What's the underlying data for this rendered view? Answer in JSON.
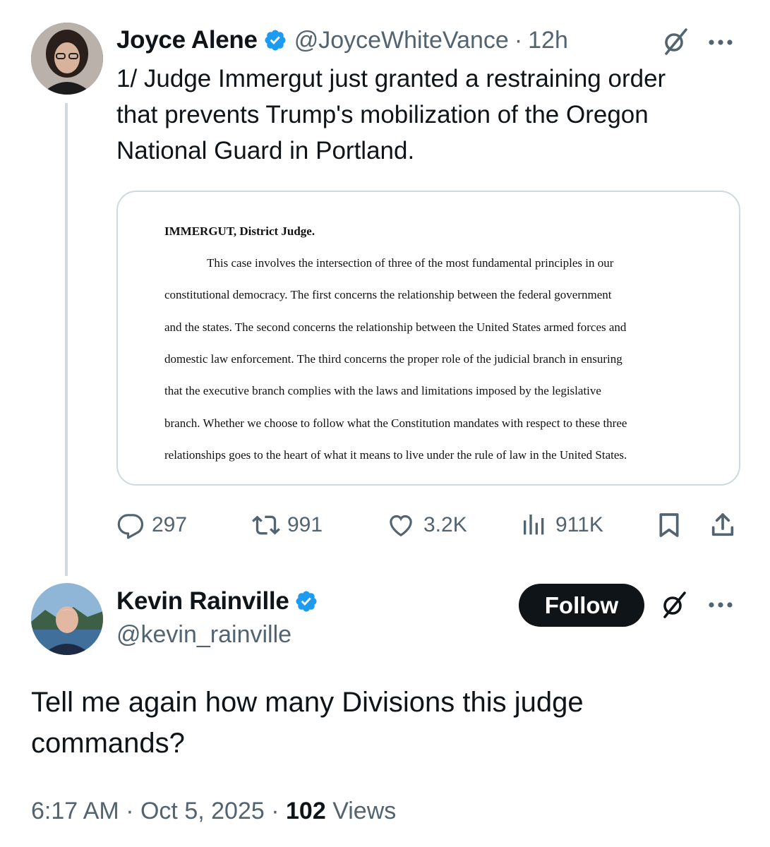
{
  "tweet1": {
    "author_name": "Joyce Alene",
    "handle": "@JoyceWhiteVance",
    "separator": "·",
    "time": "12h",
    "text_lines": [
      "1/ Judge Immergut just granted a restraining order",
      "that prevents Trump's mobilization of the Oregon",
      "National Guard in Portland."
    ],
    "document": {
      "heading": "IMMERGUT, District Judge.",
      "lines": [
        "This case involves the intersection of three of the most fundamental principles in our",
        "constitutional democracy. The first concerns the relationship between the federal government",
        "and the states. The second concerns the relationship between the United States armed forces and",
        "domestic law enforcement. The third concerns the proper role of the judicial branch in ensuring",
        "that the executive branch complies with the laws and limitations imposed by the legislative",
        "branch. Whether we choose to follow what the Constitution mandates with respect to these three",
        "relationships goes to the heart of what it means to live under the rule of law in the United States."
      ]
    },
    "stats": {
      "replies": "297",
      "reposts": "991",
      "likes": "3.2K",
      "views": "911K"
    }
  },
  "tweet2": {
    "author_name": "Kevin Rainville",
    "handle": "@kevin_rainville",
    "follow_label": "Follow",
    "text_lines": [
      "Tell me again how many Divisions this judge",
      "commands?"
    ],
    "time": "6:17 AM",
    "separator": "·",
    "date": "Oct 5, 2025",
    "views_count": "102",
    "views_label": "Views"
  },
  "icons": {
    "verified": "verified-badge-icon",
    "grok": "grok-icon",
    "more": "more-icon",
    "reply": "reply-icon",
    "repost": "repost-icon",
    "like": "like-icon",
    "views": "views-icon",
    "bookmark": "bookmark-icon",
    "share": "share-icon"
  },
  "colors": {
    "verified": "#1d9bf0",
    "text": "#0f1419",
    "secondary": "#536471",
    "border": "#cfd9de"
  }
}
